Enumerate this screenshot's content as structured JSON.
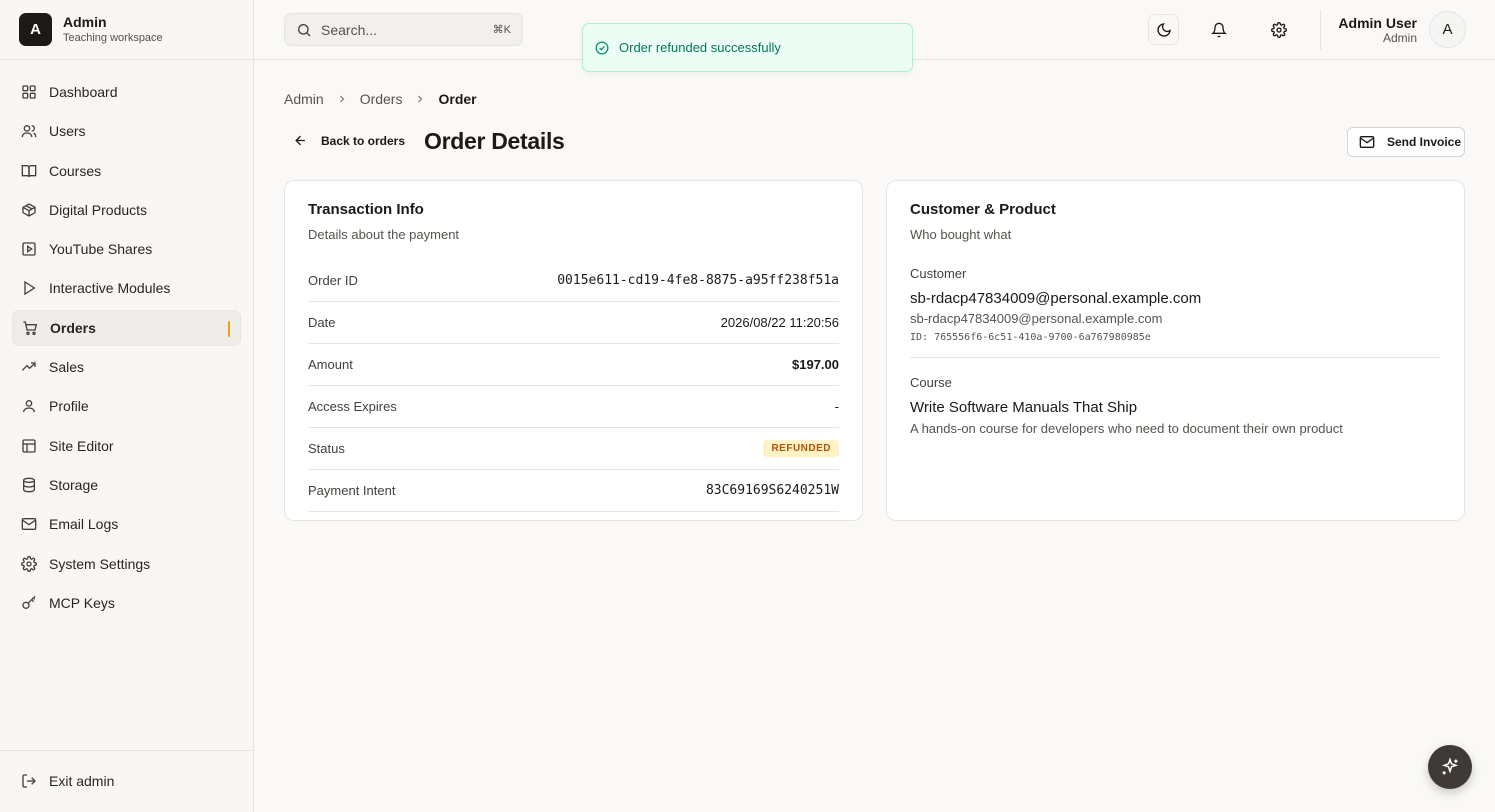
{
  "brand": {
    "initial": "A",
    "name": "Admin",
    "subtitle": "Teaching workspace"
  },
  "sidebar": {
    "items": [
      {
        "label": "Dashboard",
        "icon": "grid-icon"
      },
      {
        "label": "Users",
        "icon": "users-icon"
      },
      {
        "label": "Courses",
        "icon": "book-icon"
      },
      {
        "label": "Digital Products",
        "icon": "package-icon"
      },
      {
        "label": "YouTube Shares",
        "icon": "video-icon"
      },
      {
        "label": "Interactive Modules",
        "icon": "play-icon"
      },
      {
        "label": "Orders",
        "icon": "cart-icon",
        "active": true
      },
      {
        "label": "Sales",
        "icon": "trending-up-icon"
      },
      {
        "label": "Profile",
        "icon": "user-icon"
      },
      {
        "label": "Site Editor",
        "icon": "layout-icon"
      },
      {
        "label": "Storage",
        "icon": "database-icon"
      },
      {
        "label": "Email Logs",
        "icon": "mail-icon"
      },
      {
        "label": "System Settings",
        "icon": "gear-icon"
      },
      {
        "label": "MCP Keys",
        "icon": "key-icon"
      }
    ],
    "exit_label": "Exit admin"
  },
  "header": {
    "search_placeholder": "Search...",
    "search_shortcut": "⌘K",
    "user_name": "Admin User",
    "user_role": "Admin",
    "avatar_initial": "A"
  },
  "toast": {
    "message": "Order refunded successfully",
    "color": "#047857"
  },
  "breadcrumb": {
    "items": [
      "Admin",
      "Orders"
    ],
    "current": "Order"
  },
  "page": {
    "back_label": "Back to orders",
    "title": "Order Details",
    "send_invoice_label": "Send Invoice"
  },
  "transaction": {
    "title": "Transaction Info",
    "subtitle": "Details about the payment",
    "rows": {
      "order_id": {
        "label": "Order ID",
        "value": "0015e611-cd19-4fe8-8875-a95ff238f51a"
      },
      "date": {
        "label": "Date",
        "value": "2026/08/22 11:20:56"
      },
      "amount": {
        "label": "Amount",
        "value": "$197.00"
      },
      "access_expires": {
        "label": "Access Expires",
        "value": "-"
      },
      "status": {
        "label": "Status",
        "value": "REFUNDED"
      },
      "payment_intent": {
        "label": "Payment Intent",
        "value": "83C69169S6240251W"
      }
    }
  },
  "customer_product": {
    "title": "Customer & Product",
    "subtitle": "Who bought what",
    "customer_label": "Customer",
    "customer_name": "sb-rdacp47834009@personal.example.com",
    "customer_email": "sb-rdacp47834009@personal.example.com",
    "customer_id": "ID: 765556f6-6c51-410a-9700-6a767980985e",
    "course_label": "Course",
    "course_title": "Write Software Manuals That Ship",
    "course_description": "A hands-on course for developers who need to document their own product"
  },
  "colors": {
    "accent": "#f59e0b",
    "status_refunded_bg": "#fef3c7",
    "status_refunded_text": "#b45309"
  }
}
